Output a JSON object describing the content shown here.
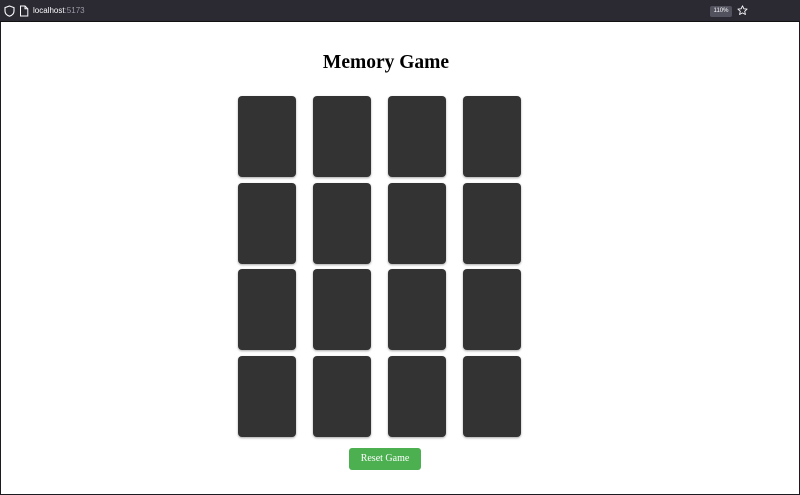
{
  "browser": {
    "url_host": "localhost",
    "url_port": ":5173",
    "zoom_level": "110%"
  },
  "game": {
    "title": "Memory Game",
    "card_count": 16,
    "card_state": "face-down",
    "card_color": "#333333",
    "reset_label": "Reset Game",
    "reset_color": "#4caf50"
  },
  "icons": {
    "tracking_protection": "shield-icon",
    "page_info": "page-icon",
    "bookmark": "star-icon"
  }
}
